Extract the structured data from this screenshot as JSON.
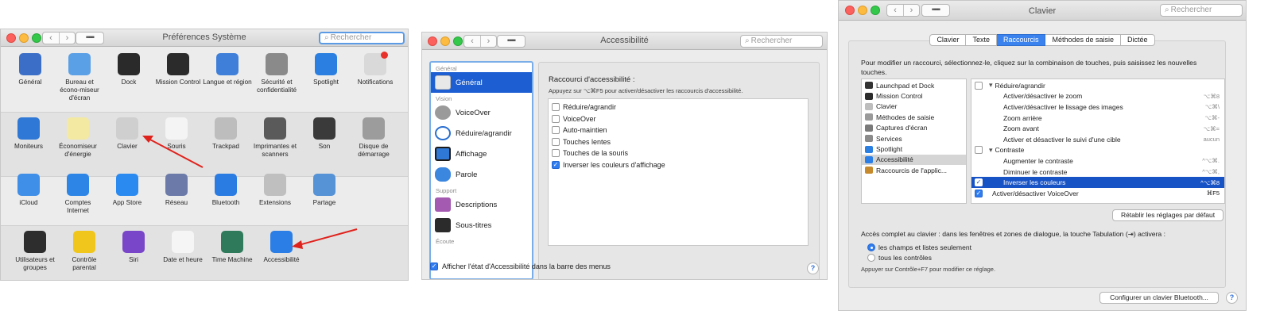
{
  "w1": {
    "title": "Préférences Système",
    "search_placeholder": "Rechercher",
    "row1": [
      {
        "label": "Général",
        "icon": "general-icon",
        "color": "#3b6fc7"
      },
      {
        "label": "Bureau et écono-miseur d'écran",
        "icon": "desktop-screensaver-icon",
        "color": "#5aa0e6"
      },
      {
        "label": "Dock",
        "icon": "dock-icon",
        "color": "#2a2a2a"
      },
      {
        "label": "Mission Control",
        "icon": "mission-control-icon",
        "color": "#2b2b2b"
      },
      {
        "label": "Langue et région",
        "icon": "language-region-icon",
        "color": "#3f7fd9"
      },
      {
        "label": "Sécurité et confidentialité",
        "icon": "security-house-icon",
        "color": "#8a8a8a"
      },
      {
        "label": "Spotlight",
        "icon": "spotlight-icon",
        "color": "#2a7fe0"
      },
      {
        "label": "Notifications",
        "icon": "notifications-icon",
        "color": "#d9d9d9"
      }
    ],
    "row2": [
      {
        "label": "Moniteurs",
        "icon": "monitor-icon",
        "color": "#2f78d6"
      },
      {
        "label": "Économiseur d'énergie",
        "icon": "lightbulb-icon",
        "color": "#f3e9a2"
      },
      {
        "label": "Clavier",
        "icon": "keyboard-icon",
        "color": "#cfcfcf"
      },
      {
        "label": "Souris",
        "icon": "mouse-icon",
        "color": "#f4f4f4"
      },
      {
        "label": "Trackpad",
        "icon": "trackpad-icon",
        "color": "#bdbdbd"
      },
      {
        "label": "Imprimantes et scanners",
        "icon": "printer-icon",
        "color": "#5a5a5a"
      },
      {
        "label": "Son",
        "icon": "speaker-icon",
        "color": "#3a3a3a"
      },
      {
        "label": "Disque de démarrage",
        "icon": "startup-disk-icon",
        "color": "#9c9c9c"
      }
    ],
    "row3": [
      {
        "label": "iCloud",
        "icon": "icloud-icon",
        "color": "#3f8ee8"
      },
      {
        "label": "Comptes Internet",
        "icon": "internet-accounts-icon",
        "color": "#2d86e6"
      },
      {
        "label": "App Store",
        "icon": "app-store-icon",
        "color": "#2a8af0"
      },
      {
        "label": "Réseau",
        "icon": "network-globe-icon",
        "color": "#6b7aa8"
      },
      {
        "label": "Bluetooth",
        "icon": "bluetooth-icon",
        "color": "#2a7be2"
      },
      {
        "label": "Extensions",
        "icon": "extensions-icon",
        "color": "#bfbfbf"
      },
      {
        "label": "Partage",
        "icon": "sharing-icon",
        "color": "#5592d6"
      }
    ],
    "row4": [
      {
        "label": "Utilisateurs et groupes",
        "icon": "users-groups-icon",
        "color": "#2d2d2d"
      },
      {
        "label": "Contrôle parental",
        "icon": "parental-controls-icon",
        "color": "#f0c61d"
      },
      {
        "label": "Siri",
        "icon": "siri-icon",
        "color": "#7a46c9"
      },
      {
        "label": "Date et heure",
        "icon": "clock-icon",
        "color": "#f5f5f5"
      },
      {
        "label": "Time Machine",
        "icon": "time-machine-icon",
        "color": "#2f7a5b"
      },
      {
        "label": "Accessibilité",
        "icon": "accessibility-icon",
        "color": "#2a7ee6"
      }
    ]
  },
  "w2": {
    "title": "Accessibilité",
    "search_placeholder": "Rechercher",
    "groups": {
      "general": "Général",
      "vision": "Vision",
      "support": "Support",
      "ecoute": "Écoute"
    },
    "items": {
      "general": "Général",
      "voiceover": "VoiceOver",
      "reduire": "Réduire/agrandir",
      "affichage": "Affichage",
      "parole": "Parole",
      "descriptions": "Descriptions",
      "soustitres": "Sous-titres"
    },
    "panel_title": "Raccourci d'accessibilité :",
    "panel_hint": "Appuyez sur ⌥⌘F5 pour activer/désactiver les raccourcis d'accessibilité.",
    "options": [
      {
        "label": "Réduire/agrandir",
        "checked": false
      },
      {
        "label": "VoiceOver",
        "checked": false
      },
      {
        "label": "Auto-maintien",
        "checked": false
      },
      {
        "label": "Touches lentes",
        "checked": false
      },
      {
        "label": "Touches de la souris",
        "checked": false
      },
      {
        "label": "Inverser les couleurs d'affichage",
        "checked": true
      }
    ],
    "footer_check": "Afficher l'état d'Accessibilité dans la barre des menus",
    "help": "?"
  },
  "w3": {
    "title": "Clavier",
    "search_placeholder": "Rechercher",
    "tabs": [
      "Clavier",
      "Texte",
      "Raccourcis",
      "Méthodes de saisie",
      "Dictée"
    ],
    "active_tab": "Raccourcis",
    "instructions": "Pour modifier un raccourci, sélectionnez-le, cliquez sur la combinaison de touches, puis saisissez les nouvelles touches.",
    "categories": [
      {
        "label": "Launchpad et Dock",
        "color": "#333333"
      },
      {
        "label": "Mission Control",
        "color": "#2b2b2b"
      },
      {
        "label": "Clavier",
        "color": "#bdbdbd"
      },
      {
        "label": "Méthodes de saisie",
        "color": "#9a9a9a"
      },
      {
        "label": "Captures d'écran",
        "color": "#7a7a7a"
      },
      {
        "label": "Services",
        "color": "#8a8a8a"
      },
      {
        "label": "Spotlight",
        "color": "#2a7fe0"
      },
      {
        "label": "Accessibilité",
        "color": "#2a7ee6"
      },
      {
        "label": "Raccourcis de l'applic...",
        "color": "#c68a2c"
      }
    ],
    "shortcuts": [
      {
        "label": "Réduire/agrandir",
        "key": "",
        "checkbox": true,
        "checked": false,
        "indent": 0,
        "disclosure": true
      },
      {
        "label": "Activer/désactiver le zoom",
        "key": "⌥⌘8",
        "checkbox": false,
        "indent": 1
      },
      {
        "label": "Activer/désactiver le lissage des images",
        "key": "⌥⌘\\",
        "checkbox": false,
        "indent": 1
      },
      {
        "label": "Zoom arrière",
        "key": "⌥⌘-",
        "checkbox": false,
        "indent": 1
      },
      {
        "label": "Zoom avant",
        "key": "⌥⌘=",
        "checkbox": false,
        "indent": 1
      },
      {
        "label": "Activer et désactiver le suivi d'une cible",
        "key": "aucun",
        "checkbox": false,
        "indent": 1
      },
      {
        "label": "Contraste",
        "key": "",
        "checkbox": true,
        "checked": false,
        "indent": 0,
        "disclosure": true
      },
      {
        "label": "Augmenter le contraste",
        "key": "^⌥⌘.",
        "checkbox": false,
        "indent": 1
      },
      {
        "label": "Diminuer le contraste",
        "key": "^⌥⌘,",
        "checkbox": false,
        "indent": 1
      },
      {
        "label": "Inverser les couleurs",
        "key": "^⌥⌘8",
        "checkbox": true,
        "checked": true,
        "indent": 1,
        "selected": true
      },
      {
        "label": "Activer/désactiver VoiceOver",
        "key": "⌘F5",
        "checkbox": true,
        "checked": true,
        "indent": 0,
        "dark": true
      }
    ],
    "restore_button": "Rétablir les réglages par défaut",
    "full_access_label": "Accès complet au clavier : dans les fenêtres et zones de dialogue, la touche Tabulation (⇥) activera :",
    "radio_options": [
      {
        "label": "les champs et listes seulement",
        "checked": true
      },
      {
        "label": "tous les contrôles",
        "checked": false
      }
    ],
    "hint": "Appuyer sur Contrôle+F7 pour modifier ce réglage.",
    "bluetooth_button": "Configurer un clavier Bluetooth...",
    "help": "?"
  }
}
